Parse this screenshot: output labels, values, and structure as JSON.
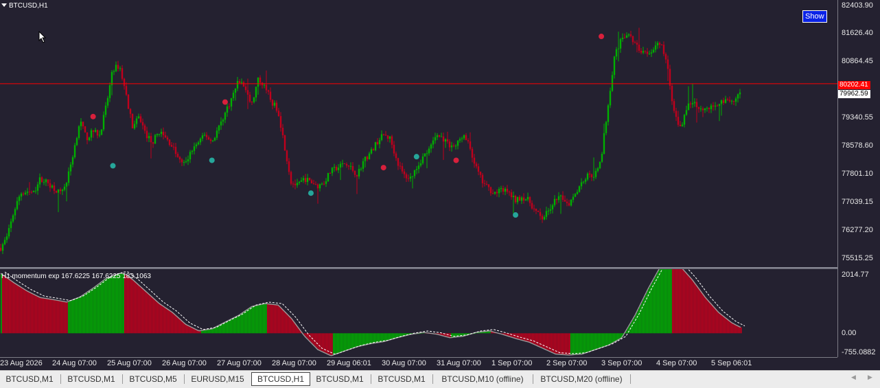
{
  "chart": {
    "symbol": "BTCUSD,H1",
    "show_button": "Show",
    "bid_price_tag": "80202.41",
    "last_price_tag": "79962.59",
    "colors": {
      "background": "#242130",
      "bull": "#00b000",
      "bear": "#c0001c",
      "price_line": "#ff0000",
      "arrow_up": "#26a69a",
      "arrow_down": "#d8203c"
    },
    "price_ticks": [
      "82403.90",
      "81626.40",
      "80864.45",
      "79340.55",
      "78578.60",
      "77801.10",
      "77039.15",
      "76277.20",
      "75515.25"
    ],
    "time_ticks": [
      "23 Aug 2026",
      "24 Aug 07:00",
      "25 Aug 07:00",
      "26 Aug 07:00",
      "27 Aug 07:00",
      "28 Aug 07:00",
      "29 Aug 06:01",
      "30 Aug 07:00",
      "31 Aug 07:00",
      "1 Sep 07:00",
      "2 Sep 07:00",
      "3 Sep 07:00",
      "4 Sep 07:00",
      "5 Sep 06:01"
    ]
  },
  "indicator": {
    "label": "H1 momentum exp  167.6225 167.6225 183.1063",
    "ticks": [
      "2014.77",
      "0.00",
      "-755.0882"
    ]
  },
  "chart_data": {
    "type": "candlestick",
    "price_range": [
      75150,
      82500
    ],
    "bid_price": 80202.41,
    "last_price": 79962.59,
    "price_anchors": [
      [
        0,
        75700
      ],
      [
        1,
        76000
      ],
      [
        2,
        76700
      ],
      [
        3,
        77200
      ],
      [
        4,
        77250
      ],
      [
        5,
        77200
      ],
      [
        6,
        77600
      ],
      [
        7,
        77500
      ],
      [
        8,
        77350
      ],
      [
        9,
        77200
      ],
      [
        10,
        77500
      ],
      [
        11,
        78300
      ],
      [
        12,
        79200
      ],
      [
        13,
        78700
      ],
      [
        14,
        78900
      ],
      [
        15,
        78800
      ],
      [
        16,
        79600
      ],
      [
        17,
        80600
      ],
      [
        18,
        80700
      ],
      [
        19,
        79900
      ],
      [
        20,
        79000
      ],
      [
        21,
        79300
      ],
      [
        22,
        78800
      ],
      [
        23,
        78600
      ],
      [
        24,
        78900
      ],
      [
        25,
        78700
      ],
      [
        26,
        78500
      ],
      [
        27,
        78100
      ],
      [
        28,
        78000
      ],
      [
        29,
        78400
      ],
      [
        30,
        78600
      ],
      [
        31,
        78800
      ],
      [
        32,
        78600
      ],
      [
        33,
        79000
      ],
      [
        34,
        79400
      ],
      [
        35,
        79800
      ],
      [
        36,
        80300
      ],
      [
        37,
        80100
      ],
      [
        38,
        79600
      ],
      [
        39,
        80300
      ],
      [
        40,
        80200
      ],
      [
        41,
        79700
      ],
      [
        42,
        79500
      ],
      [
        43,
        78500
      ],
      [
        44,
        77500
      ],
      [
        45,
        77400
      ],
      [
        46,
        77600
      ],
      [
        47,
        77500
      ],
      [
        48,
        77400
      ],
      [
        49,
        77500
      ],
      [
        50,
        77800
      ],
      [
        51,
        77900
      ],
      [
        52,
        78000
      ],
      [
        53,
        77900
      ],
      [
        54,
        77700
      ],
      [
        55,
        78100
      ],
      [
        56,
        78300
      ],
      [
        57,
        78600
      ],
      [
        58,
        78800
      ],
      [
        59,
        78700
      ],
      [
        60,
        78100
      ],
      [
        61,
        77700
      ],
      [
        62,
        77600
      ],
      [
        63,
        77900
      ],
      [
        64,
        78200
      ],
      [
        65,
        78400
      ],
      [
        66,
        78800
      ],
      [
        67,
        78700
      ],
      [
        68,
        78500
      ],
      [
        69,
        78500
      ],
      [
        70,
        78800
      ],
      [
        71,
        78500
      ],
      [
        72,
        77900
      ],
      [
        73,
        77500
      ],
      [
        74,
        77300
      ],
      [
        75,
        77200
      ],
      [
        76,
        77300
      ],
      [
        77,
        77200
      ],
      [
        78,
        77000
      ],
      [
        79,
        77100
      ],
      [
        80,
        77000
      ],
      [
        81,
        76700
      ],
      [
        82,
        76500
      ],
      [
        83,
        76700
      ],
      [
        84,
        77000
      ],
      [
        85,
        77100
      ],
      [
        86,
        76900
      ],
      [
        87,
        77200
      ],
      [
        88,
        77500
      ],
      [
        89,
        77700
      ],
      [
        90,
        77700
      ],
      [
        91,
        78200
      ],
      [
        92,
        79600
      ],
      [
        93,
        81000
      ],
      [
        94,
        81400
      ],
      [
        95,
        81600
      ],
      [
        96,
        81300
      ],
      [
        97,
        81100
      ],
      [
        98,
        81000
      ],
      [
        99,
        81200
      ],
      [
        100,
        81300
      ],
      [
        101,
        80700
      ],
      [
        102,
        79400
      ],
      [
        103,
        79000
      ],
      [
        104,
        79600
      ],
      [
        105,
        79700
      ],
      [
        106,
        79550
      ],
      [
        107,
        79500
      ],
      [
        108,
        79600
      ],
      [
        109,
        79700
      ],
      [
        110,
        79800
      ],
      [
        111,
        79700
      ],
      [
        112,
        80000
      ]
    ],
    "buy_arrows": [
      [
        17,
        77950
      ],
      [
        32,
        78100
      ],
      [
        47,
        77200
      ],
      [
        63,
        78200
      ],
      [
        78,
        76600
      ]
    ],
    "sell_arrows": [
      [
        14,
        79300
      ],
      [
        34,
        79700
      ],
      [
        58,
        77900
      ],
      [
        69,
        78100
      ],
      [
        91,
        81500
      ]
    ],
    "indicator_range": [
      -755.0882,
      2014.77
    ],
    "momentum_anchors": [
      [
        0,
        2014
      ],
      [
        3,
        1700
      ],
      [
        6,
        1420
      ],
      [
        9,
        1200
      ],
      [
        12,
        1130
      ],
      [
        15,
        1050
      ],
      [
        18,
        1220
      ],
      [
        21,
        1520
      ],
      [
        24,
        1850
      ],
      [
        27,
        2014
      ],
      [
        28,
        2014
      ],
      [
        30,
        1800
      ],
      [
        33,
        1400
      ],
      [
        36,
        1000
      ],
      [
        39,
        700
      ],
      [
        42,
        300
      ],
      [
        45,
        80
      ],
      [
        48,
        150
      ],
      [
        51,
        380
      ],
      [
        54,
        600
      ],
      [
        57,
        900
      ],
      [
        60,
        1000
      ],
      [
        63,
        950
      ],
      [
        66,
        500
      ],
      [
        69,
        -100
      ],
      [
        72,
        -550
      ],
      [
        75,
        -755
      ],
      [
        78,
        -600
      ],
      [
        81,
        -450
      ],
      [
        84,
        -350
      ],
      [
        87,
        -280
      ],
      [
        90,
        -150
      ],
      [
        93,
        -40
      ],
      [
        96,
        30
      ],
      [
        99,
        -30
      ],
      [
        102,
        -150
      ],
      [
        105,
        -100
      ],
      [
        108,
        30
      ],
      [
        111,
        80
      ],
      [
        114,
        -40
      ],
      [
        117,
        -180
      ],
      [
        120,
        -300
      ],
      [
        123,
        -500
      ],
      [
        126,
        -700
      ],
      [
        129,
        -730
      ],
      [
        132,
        -700
      ],
      [
        135,
        -550
      ],
      [
        138,
        -400
      ],
      [
        141,
        -150
      ],
      [
        144,
        600
      ],
      [
        147,
        1500
      ],
      [
        150,
        2300
      ],
      [
        152,
        2450
      ],
      [
        154,
        2300
      ],
      [
        157,
        1800
      ],
      [
        160,
        1200
      ],
      [
        163,
        700
      ],
      [
        166,
        350
      ],
      [
        168,
        200
      ]
    ]
  },
  "tabs": [
    {
      "label": "BTCUSD,M1"
    },
    {
      "label": "BTCUSD,M1"
    },
    {
      "label": "BTCUSD,M5"
    },
    {
      "label": "EURUSD,M15"
    },
    {
      "label": "BTCUSD,H1"
    },
    {
      "label": "BTCUSD,M1"
    },
    {
      "label": "BTCUSD,M1"
    },
    {
      "label": "BTCUSD,M10 (offline)"
    },
    {
      "label": "BTCUSD,M20 (offline)"
    }
  ],
  "active_tab": 4
}
